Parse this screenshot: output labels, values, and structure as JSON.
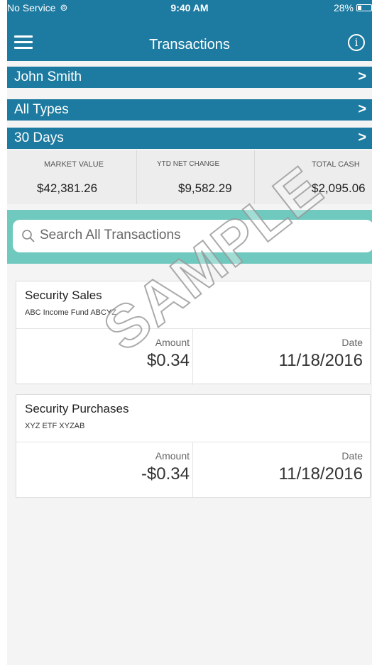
{
  "status_bar": {
    "carrier": "No Service",
    "time": "9:40 AM",
    "battery": "28%",
    "battery_level": 0.28
  },
  "header": {
    "title": "Transactions"
  },
  "filters": [
    {
      "label": "John Smith",
      "chevron": ">"
    },
    {
      "label": "All Types",
      "chevron": ">"
    },
    {
      "label": "30 Days",
      "chevron": ">"
    }
  ],
  "summary": [
    {
      "label": "MARKET VALUE",
      "value": "$42,381.26"
    },
    {
      "label": "YTD NET CHANGE",
      "value": "$9,582.29"
    },
    {
      "label": "TOTAL CASH",
      "value": "$2,095.06"
    }
  ],
  "search": {
    "placeholder": "Search All Transactions"
  },
  "transactions": [
    {
      "type": "Security Sales",
      "security": "ABC Income Fund  ABCYZ",
      "amount_label": "Amount",
      "amount": "$0.34",
      "date_label": "Date",
      "date": "11/18/2016"
    },
    {
      "type": "Security Purchases",
      "security": "XYZ ETF  XYZAB",
      "amount_label": "Amount",
      "amount": "-$0.34",
      "date_label": "Date",
      "date": "11/18/2016"
    }
  ],
  "watermark": "SAMPLE",
  "colors": {
    "primary": "#1d7aa0",
    "search_band": "#6fc9bf",
    "background": "#f4f4f4"
  },
  "icons": [
    "wifi-signal-icon",
    "battery-icon",
    "hamburger-menu-icon",
    "info-icon",
    "chevron-right-icon",
    "search-icon"
  ]
}
